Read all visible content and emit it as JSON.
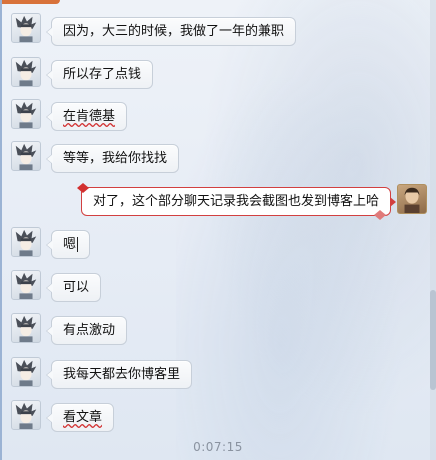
{
  "messages": [
    {
      "side": "left",
      "text": "因为，大三的时候，我做了一年的兼职"
    },
    {
      "side": "left",
      "text": "所以存了点钱"
    },
    {
      "side": "left",
      "text": "在肯德基"
    },
    {
      "side": "left",
      "text": "等等，我给你找找"
    },
    {
      "side": "right",
      "text": "对了，这个部分聊天记录我会截图也发到博客上哈"
    },
    {
      "side": "left",
      "text": "嗯"
    },
    {
      "side": "left",
      "text": "可以"
    },
    {
      "side": "left",
      "text": "有点激动"
    },
    {
      "side": "left",
      "text": "我每天都去你博客里"
    },
    {
      "side": "left",
      "text": "看文章"
    }
  ],
  "timer": "0:07:15",
  "colors": {
    "self_bubble_border": "#d24040",
    "bubble_border": "#c7cfd9",
    "background": "#e9eef6"
  }
}
